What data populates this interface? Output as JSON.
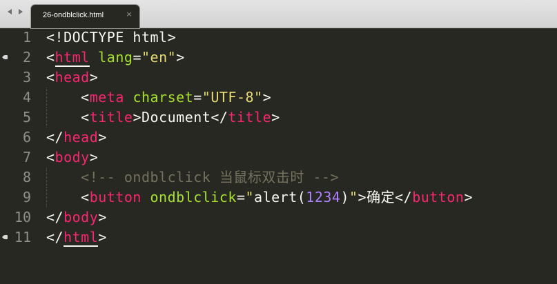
{
  "tabbar": {
    "active_tab": {
      "title": "26-ondblclick.html",
      "close_glyph": "×"
    },
    "nav_left_icon": "arrow-left-icon",
    "nav_right_icon": "arrow-right-icon"
  },
  "theme": {
    "background": "#272822",
    "text": "#f8f8f2",
    "tag": "#f92672",
    "attribute": "#a6e22e",
    "string": "#e6db74",
    "number": "#ae81ff",
    "comment": "#75715e",
    "gutter": "#90908a"
  },
  "editor": {
    "line_numbers": [
      "1",
      "2",
      "3",
      "4",
      "5",
      "6",
      "7",
      "8",
      "9",
      "10",
      "11"
    ],
    "l1": {
      "text": "<!DOCTYPE html>"
    },
    "l2": {
      "lt": "<",
      "tag": "html",
      "sp": " ",
      "attr": "lang",
      "eq": "=",
      "val": "\"en\"",
      "gt": ">"
    },
    "l3": {
      "lt": "<",
      "tag": "head",
      "gt": ">"
    },
    "l4": {
      "ind": "    ",
      "lt": "<",
      "tag": "meta",
      "sp": " ",
      "attr": "charset",
      "eq": "=",
      "val": "\"UTF-8\"",
      "gt": ">"
    },
    "l5": {
      "ind": "    ",
      "lt": "<",
      "tag": "title",
      "gt": ">",
      "content": "Document",
      "lt2": "</",
      "tag2": "title",
      "gt2": ">"
    },
    "l6": {
      "lt": "</",
      "tag": "head",
      "gt": ">"
    },
    "l7": {
      "lt": "<",
      "tag": "body",
      "gt": ">"
    },
    "l8": {
      "ind": "    ",
      "comment": "<!-- ondblclick 当鼠标双击时 -->"
    },
    "l9": {
      "ind": "    ",
      "lt": "<",
      "tag": "button",
      "sp": " ",
      "attr": "ondblclick",
      "eq": "=",
      "q1": "\"",
      "fn": "alert(",
      "num": "1234",
      "fn2": ")",
      "q2": "\"",
      "gt": ">",
      "content": "确定",
      "lt2": "</",
      "tag2": "button",
      "gt2": ">"
    },
    "l10": {
      "lt": "</",
      "tag": "body",
      "gt": ">"
    },
    "l11": {
      "lt": "</",
      "tag": "html",
      "gt": ">"
    }
  }
}
